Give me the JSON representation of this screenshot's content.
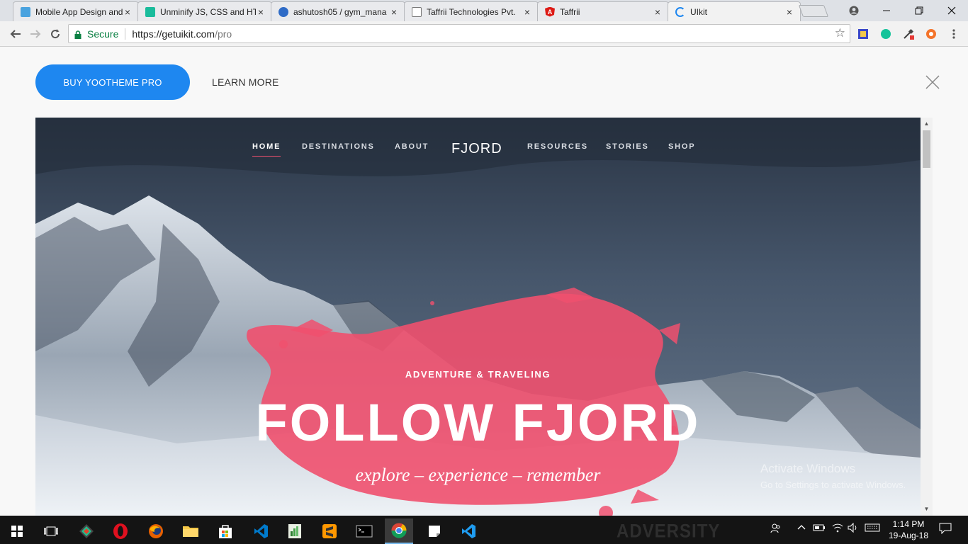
{
  "browser": {
    "tabs": [
      {
        "title": "Mobile App Design and",
        "favicon_color": "#4aa3df",
        "active": false
      },
      {
        "title": "Unminify JS, CSS and HT",
        "favicon_color": "#1abc9c",
        "active": false
      },
      {
        "title": "ashutosh05 / gym_mana",
        "favicon_color": "#2e6bc6",
        "active": false
      },
      {
        "title": "Taffrii Technologies Pvt.",
        "favicon_color": "#ffffff",
        "active": false
      },
      {
        "title": "Taffrii",
        "favicon_color": "#dd1b16",
        "active": false
      },
      {
        "title": "UIkit",
        "favicon_color": "#1e87f0",
        "active": true
      }
    ],
    "tab_close_glyph": "×",
    "secure_label": "Secure",
    "url_host": "https://getuikit.com",
    "url_path": "/pro"
  },
  "promo": {
    "buy_label": "BUY YOOTHEME PRO",
    "learn_more_label": "LEARN MORE"
  },
  "hero": {
    "nav": {
      "items": [
        "HOME",
        "DESTINATIONS",
        "ABOUT",
        "RESOURCES",
        "STORIES",
        "SHOP"
      ],
      "logo": "FJORD",
      "active_item": "HOME"
    },
    "eyebrow": "ADVENTURE & TRAVELING",
    "headline": "FOLLOW FJORD",
    "tagline": "explore – experience – remember",
    "accent_color": "#f0506e"
  },
  "watermark": {
    "title": "Activate Windows",
    "subtitle": "Go to Settings to activate Windows."
  },
  "taskbar": {
    "time": "1:14 PM",
    "date": "19-Aug-18",
    "background_text": "ADVERSITY"
  }
}
